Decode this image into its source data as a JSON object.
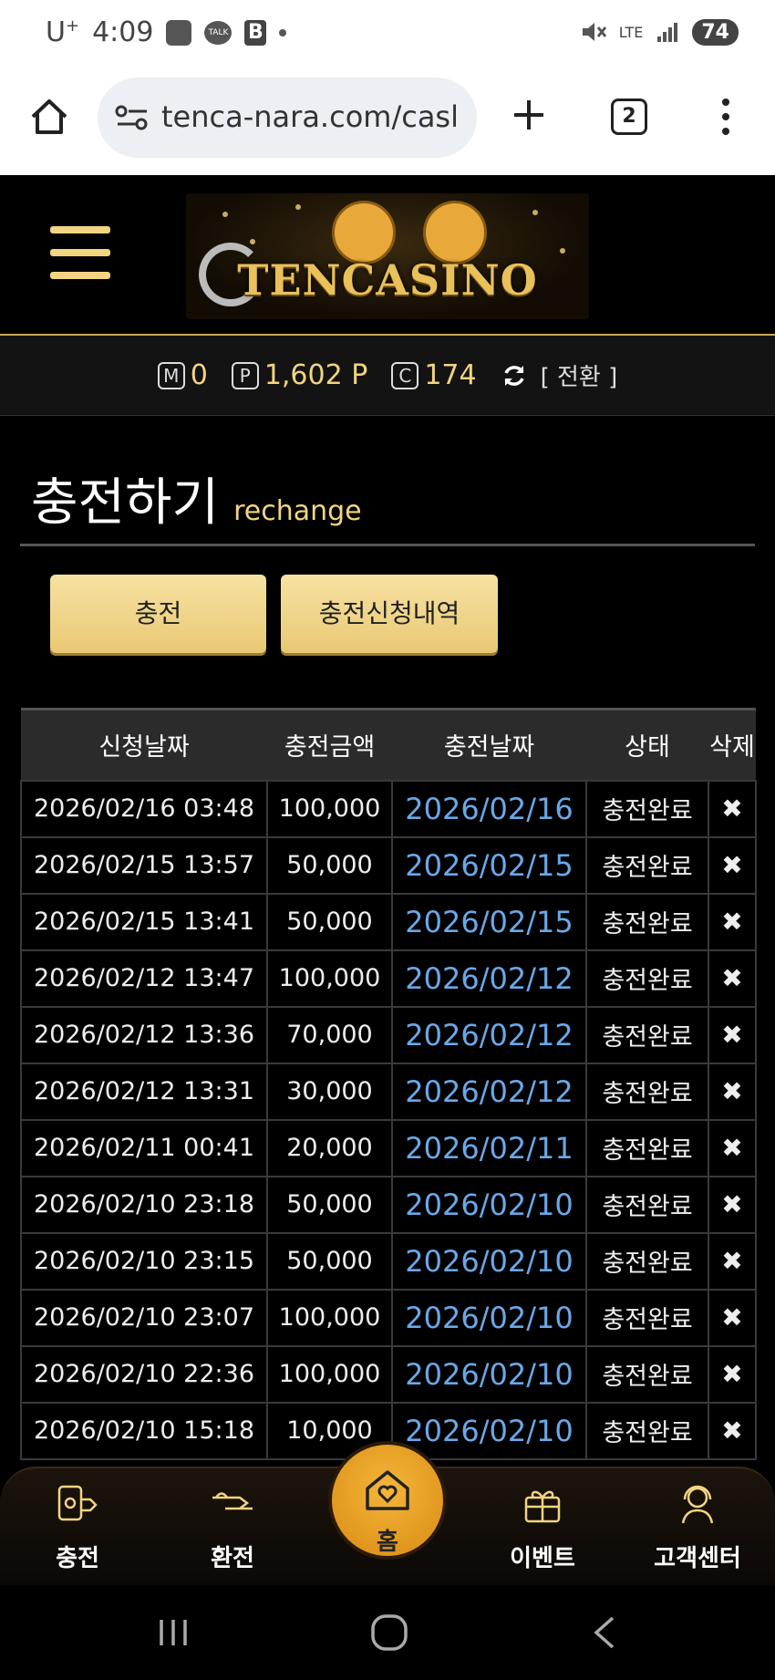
{
  "status_bar": {
    "carrier": "U",
    "time": "4:09",
    "talk_label": "TALK",
    "b_label": "B",
    "network": "LTE",
    "battery": "74"
  },
  "browser": {
    "url": "tenca-nara.com/casl",
    "tab_count": "2"
  },
  "site": {
    "logo_text": "TENCASINO"
  },
  "points": {
    "m_badge": "M",
    "m_value": "0",
    "p_badge": "P",
    "p_value": "1,602 P",
    "c_badge": "C",
    "c_value": "174",
    "switch_label": "[ 전환 ]"
  },
  "page": {
    "title_ko": "충전하기",
    "title_en": "rechange"
  },
  "buttons": {
    "charge": "충전",
    "history": "충전신청내역"
  },
  "table": {
    "headers": [
      "신청날짜",
      "충전금액",
      "충전날짜",
      "상태",
      "삭제"
    ],
    "rows": [
      {
        "requested": "2026/02/16 03:48",
        "amount": "100,000",
        "charged": "2026/02/16",
        "status": "충전완료",
        "del": "✖"
      },
      {
        "requested": "2026/02/15 13:57",
        "amount": "50,000",
        "charged": "2026/02/15",
        "status": "충전완료",
        "del": "✖"
      },
      {
        "requested": "2026/02/15 13:41",
        "amount": "50,000",
        "charged": "2026/02/15",
        "status": "충전완료",
        "del": "✖"
      },
      {
        "requested": "2026/02/12 13:47",
        "amount": "100,000",
        "charged": "2026/02/12",
        "status": "충전완료",
        "del": "✖"
      },
      {
        "requested": "2026/02/12 13:36",
        "amount": "70,000",
        "charged": "2026/02/12",
        "status": "충전완료",
        "del": "✖"
      },
      {
        "requested": "2026/02/12 13:31",
        "amount": "30,000",
        "charged": "2026/02/12",
        "status": "충전완료",
        "del": "✖"
      },
      {
        "requested": "2026/02/11 00:41",
        "amount": "20,000",
        "charged": "2026/02/11",
        "status": "충전완료",
        "del": "✖"
      },
      {
        "requested": "2026/02/10 23:18",
        "amount": "50,000",
        "charged": "2026/02/10",
        "status": "충전완료",
        "del": "✖"
      },
      {
        "requested": "2026/02/10 23:15",
        "amount": "50,000",
        "charged": "2026/02/10",
        "status": "충전완료",
        "del": "✖"
      },
      {
        "requested": "2026/02/10 23:07",
        "amount": "100,000",
        "charged": "2026/02/10",
        "status": "충전완료",
        "del": "✖"
      },
      {
        "requested": "2026/02/10 22:36",
        "amount": "100,000",
        "charged": "2026/02/10",
        "status": "충전완료",
        "del": "✖"
      },
      {
        "requested": "2026/02/10 15:18",
        "amount": "10,000",
        "charged": "2026/02/10",
        "status": "충전완료",
        "del": "✖"
      }
    ]
  },
  "bottom_nav": {
    "charge": "충전",
    "exchange": "환전",
    "home": "홈",
    "event": "이벤트",
    "support": "고객센터"
  },
  "colors": {
    "gold": "#f2d481",
    "date_link": "#6aa8e8",
    "home_button": "#e9a22a"
  }
}
